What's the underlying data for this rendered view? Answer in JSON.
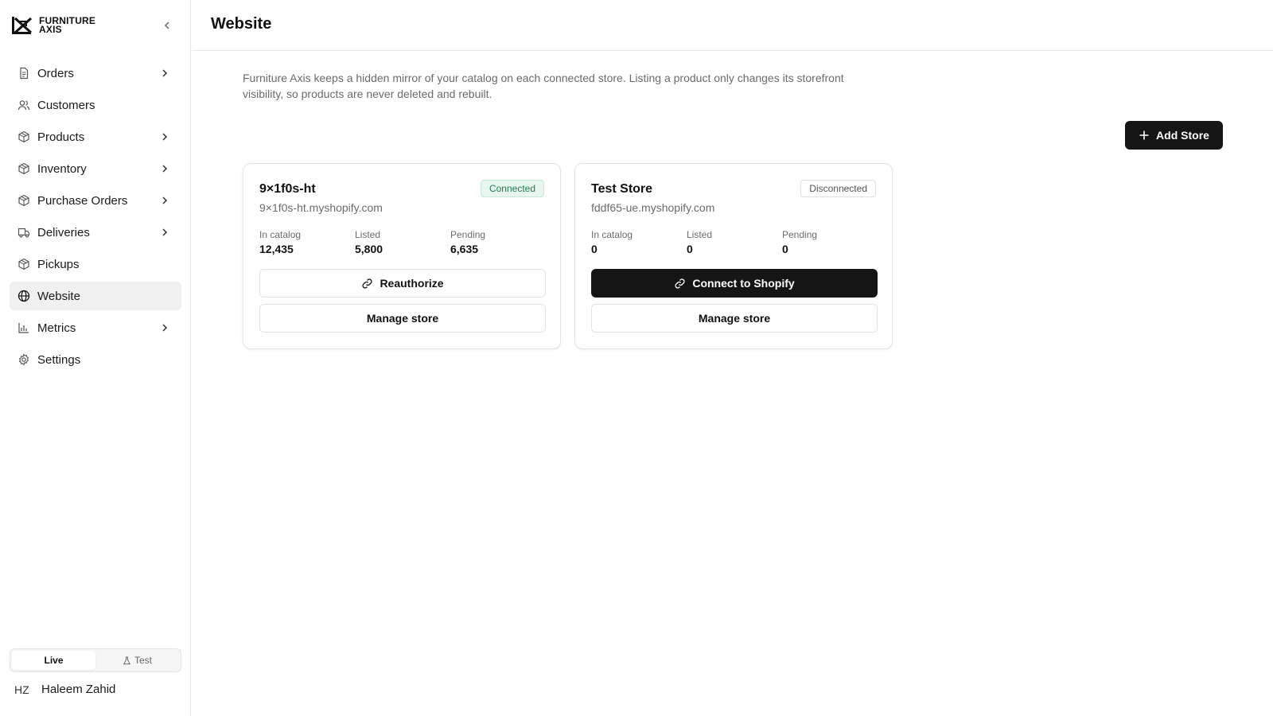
{
  "brand": {
    "line1": "FURNITURE",
    "line2": "AXIS"
  },
  "sidebar": {
    "items": [
      {
        "label": "Orders",
        "icon": "document-icon",
        "has_children": true
      },
      {
        "label": "Customers",
        "icon": "users-icon",
        "has_children": false
      },
      {
        "label": "Products",
        "icon": "box-icon",
        "has_children": true
      },
      {
        "label": "Inventory",
        "icon": "box-icon",
        "has_children": true
      },
      {
        "label": "Purchase Orders",
        "icon": "box-icon",
        "has_children": true
      },
      {
        "label": "Deliveries",
        "icon": "truck-icon",
        "has_children": true
      },
      {
        "label": "Pickups",
        "icon": "box-icon",
        "has_children": false
      },
      {
        "label": "Website",
        "icon": "globe-icon",
        "has_children": false,
        "active": true
      },
      {
        "label": "Metrics",
        "icon": "bar-chart-icon",
        "has_children": true
      },
      {
        "label": "Settings",
        "icon": "gear-icon",
        "has_children": false
      }
    ],
    "env": {
      "live": "Live",
      "test": "Test",
      "selected": "Live"
    },
    "user": {
      "initials": "HZ",
      "name": "Haleem Zahid"
    }
  },
  "header": {
    "title": "Website"
  },
  "main": {
    "intro": "Furniture Axis keeps a hidden mirror of your catalog on each connected store. Listing a product only changes its storefront visibility, so products are never deleted and rebuilt.",
    "add_store_label": "Add Store",
    "stores": [
      {
        "name": "9×1f0s-ht",
        "domain": "9×1f0s-ht.myshopify.com",
        "status": "Connected",
        "stats": {
          "in_catalog_label": "In catalog",
          "in_catalog": "12,435",
          "listed_label": "Listed",
          "listed": "5,800",
          "pending_label": "Pending",
          "pending": "6,635"
        },
        "primary_action": "Reauthorize",
        "secondary_action": "Manage store"
      },
      {
        "name": "Test Store",
        "domain": "fddf65-ue.myshopify.com",
        "status": "Disconnected",
        "stats": {
          "in_catalog_label": "In catalog",
          "in_catalog": "0",
          "listed_label": "Listed",
          "listed": "0",
          "pending_label": "Pending",
          "pending": "0"
        },
        "primary_action": "Connect to Shopify",
        "secondary_action": "Manage store"
      }
    ]
  },
  "colors": {
    "primary_button": "#151515",
    "connected_badge": "#1d7a4a",
    "active_nav_bg": "#f0f0f1"
  }
}
